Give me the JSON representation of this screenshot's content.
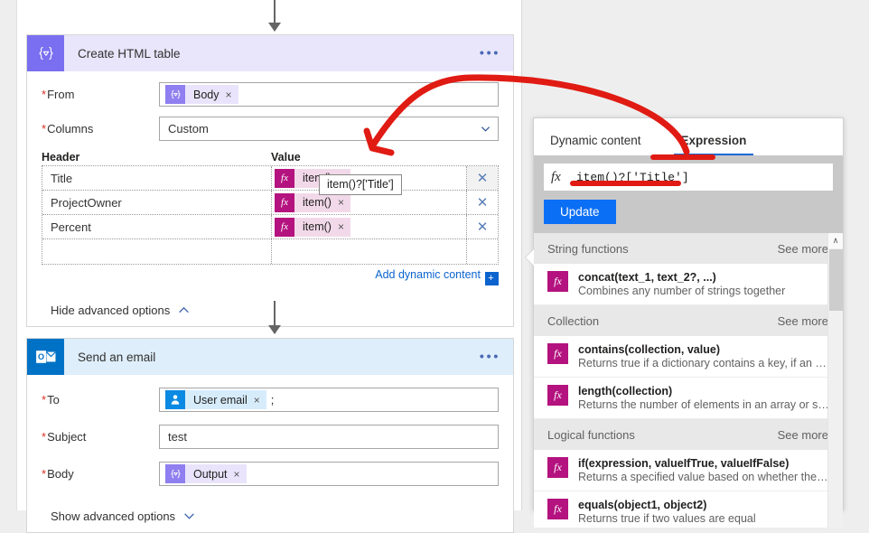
{
  "canvas": {
    "cards": [
      {
        "title": "Create HTML table",
        "icon": "expression-braces-icon",
        "menu": "•••",
        "fields": [
          {
            "label": "From",
            "required": true,
            "type": "token",
            "token": {
              "icon": "expression-braces-icon",
              "label": "Body",
              "remove": "×"
            }
          },
          {
            "label": "Columns",
            "required": true,
            "type": "dropdown",
            "value": "Custom"
          }
        ],
        "grid": {
          "headers": [
            "Header",
            "Value"
          ],
          "rows": [
            {
              "header": "Title",
              "value_token": {
                "label": "item()",
                "remove": "×"
              },
              "delete": "✕"
            },
            {
              "header": "ProjectOwner",
              "value_token": {
                "label": "item()",
                "remove": "×"
              },
              "delete": "✕"
            },
            {
              "header": "Percent",
              "value_token": {
                "label": "item()",
                "remove": "×"
              },
              "delete": "✕"
            },
            {
              "header": "",
              "value_token": null,
              "delete": ""
            }
          ]
        },
        "add_dynamic_content": "Add dynamic content",
        "add_plus": "+",
        "advanced_options": "Hide advanced options"
      },
      {
        "title": "Send an email",
        "icon": "outlook-icon",
        "menu": "•••",
        "fields": [
          {
            "label": "To",
            "required": true,
            "type": "token",
            "token": {
              "icon": "person-icon",
              "label": "User email",
              "remove": "×"
            },
            "suffix": ";"
          },
          {
            "label": "Subject",
            "required": true,
            "type": "text",
            "value": "test"
          },
          {
            "label": "Body",
            "required": true,
            "type": "token",
            "token": {
              "icon": "expression-braces-icon",
              "label": "Output",
              "remove": "×"
            }
          }
        ],
        "advanced_options": "Show advanced options"
      }
    ],
    "tooltip": "item()?['Title']"
  },
  "flyout": {
    "tabs": [
      {
        "label": "Dynamic content",
        "active": false
      },
      {
        "label": "Expression",
        "active": true
      }
    ],
    "expression": {
      "fx_glyph": "fx",
      "value": "item()?['Title']",
      "update_label": "Update"
    },
    "sections": [
      {
        "name": "String functions",
        "see_more": "See more",
        "items": [
          {
            "signature": "concat(text_1, text_2?, ...)",
            "description": "Combines any number of strings together"
          }
        ]
      },
      {
        "name": "Collection",
        "see_more": "See more",
        "items": [
          {
            "signature": "contains(collection, value)",
            "description": "Returns true if a dictionary contains a key, if an arra..."
          },
          {
            "signature": "length(collection)",
            "description": "Returns the number of elements in an array or string"
          }
        ]
      },
      {
        "name": "Logical functions",
        "see_more": "See more",
        "items": [
          {
            "signature": "if(expression, valueIfTrue, valueIfFalse)",
            "description": "Returns a specified value based on whether the exp..."
          },
          {
            "signature": "equals(object1, object2)",
            "description": "Returns true if two values are equal"
          }
        ]
      }
    ],
    "scrollbar": {
      "up_arrow": "∧"
    }
  },
  "colors": {
    "accent_purple": "#7a6ff0",
    "accent_blue": "#0072c6",
    "fx_magenta": "#b4127f",
    "link_blue": "#0b63ce",
    "button_blue": "#0b6ff5",
    "annotation_red": "#e01b13"
  }
}
